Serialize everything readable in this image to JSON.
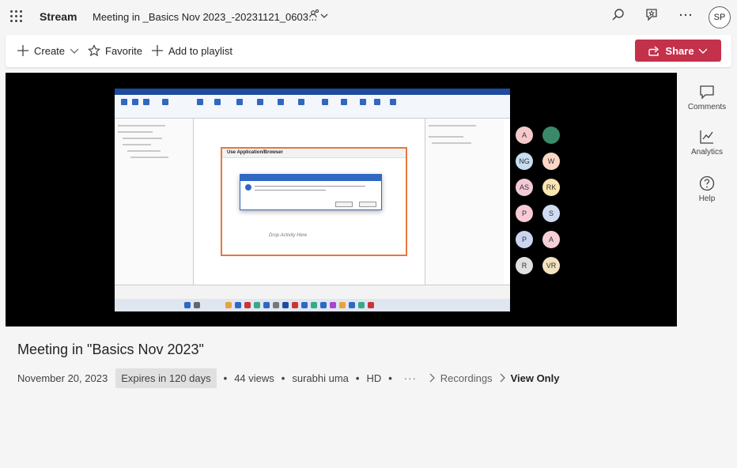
{
  "header": {
    "app_name": "Stream",
    "file_title": "Meeting in _Basics Nov 2023_-20231121_0603...",
    "user_initials": "SP"
  },
  "toolbar": {
    "create_label": "Create",
    "favorite_label": "Favorite",
    "playlist_label": "Add to playlist",
    "share_label": "Share"
  },
  "rail": {
    "comments_label": "Comments",
    "analytics_label": "Analytics",
    "help_label": "Help"
  },
  "video": {
    "activity_title": "Use Application/Browser",
    "drop_text": "Drop Activity Here"
  },
  "meta": {
    "title": "Meeting in \"Basics Nov 2023\"",
    "date": "November 20, 2023",
    "expires": "Expires in 120 days",
    "views": "44 views",
    "owner": "surabhi uma",
    "quality": "HD",
    "breadcrumb_1": "Recordings",
    "breadcrumb_2": "View Only"
  },
  "colors": {
    "accent": "#c4314b",
    "text": "#242424",
    "background": "#f5f5f5"
  }
}
